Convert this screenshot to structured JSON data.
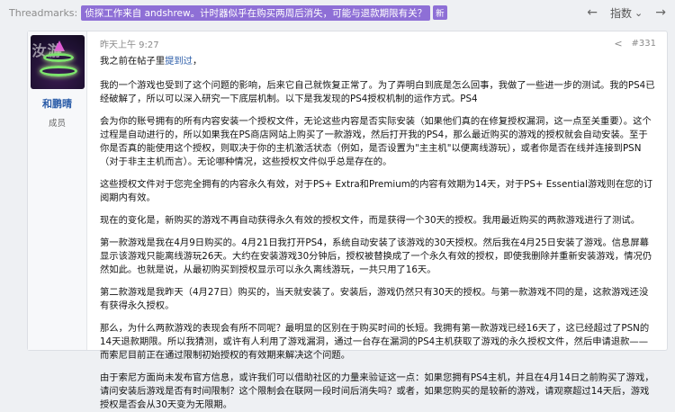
{
  "topbar": {
    "label": "Threadmarks:",
    "thread_title": "侦探工作来自 andshrew。计时器似乎在购买两周后消失，可能与退款期限有关？",
    "new_badge": "新",
    "prev_arrow": "←",
    "next_arrow": "→",
    "index_label": "指数",
    "index_chevron": "⌄"
  },
  "user": {
    "name": "和鹏晴",
    "role": "成员",
    "avatar_watermark": "汝游"
  },
  "post": {
    "timestamp": "昨天上午 9:27",
    "share_icon": "share-icon",
    "post_number": "#331",
    "intro_prefix": "我之前在帖子里",
    "intro_link": "提到过",
    "intro_suffix": "，",
    "paragraphs": [
      "我的一个游戏也受到了这个问题的影响，后来它自己就恢复正常了。为了弄明白到底是怎么回事，我做了一些进一步的测试。我的PS4已经破解了，所以可以深入研究一下底层机制。以下是我发现的PS4授权机制的运作方式。PS4",
      "会为你的账号拥有的所有内容安装一个授权文件，无论这些内容是否实际安装（如果他们真的在修复授权漏洞，这一点至关重要）。这个过程是自动进行的，所以如果我在PS商店网站上购买了一款游戏，然后打开我的PS4，那么最近购买的游戏的授权就会自动安装。至于你是否真的能使用这个授权，则取决于你的主机激活状态（例如，是否设置为\"主主机\"以便离线游玩），或者你是否在线并连接到PSN（对于非主主机而言）。无论哪种情况，这些授权文件似乎总是存在的。",
      "这些授权文件对于您完全拥有的内容永久有效，对于PS+ Extra和Premium的内容有效期为14天，对于PS+ Essential游戏则在您的订阅期内有效。",
      "现在的变化是，新购买的游戏不再自动获得永久有效的授权文件，而是获得一个30天的授权。我用最近购买的两款游戏进行了测试。",
      "第一款游戏是我在4月9日购买的。4月21日我打开PS4，系统自动安装了该游戏的30天授权。然后我在4月25日安装了游戏。信息屏幕显示该游戏只能离线游玩26天。大约在安装游戏30分钟后，授权被替换成了一个永久有效的授权，即使我删除并重新安装游戏，情况仍然如此。也就是说，从最初购买到授权显示可以永久离线游玩，一共只用了16天。",
      "第二款游戏是我昨天（4月27日）购买的，当天就安装了。安装后，游戏仍然只有30天的授权。与第一款游戏不同的是，这款游戏还没有获得永久授权。",
      "那么，为什么两款游戏的表现会有所不同呢？最明显的区别在于购买时间的长短。我拥有第一款游戏已经16天了，这已经超过了PSN的14天退款期限。所以我猜测，或许有人利用了游戏漏洞，通过一台存在漏洞的PS4主机获取了游戏的永久授权文件，然后申请退款——而索尼目前正在通过限制初始授权的有效期来解决这个问题。",
      "由于索尼方面尚未发布官方信息，或许我们可以借助社区的力量来验证这一点：如果您拥有PS4主机，并且在4月14日之前购买了游戏，请问安装后游戏是否有时间限制？这个限制会在联网一段时间后消失吗？或者，如果您购买的是较新的游戏，请观察超过14天后，游戏授权是否会从30天变为无限期。"
    ]
  },
  "colors": {
    "accent": "#8e6fd6",
    "link": "#2b5ca8"
  }
}
